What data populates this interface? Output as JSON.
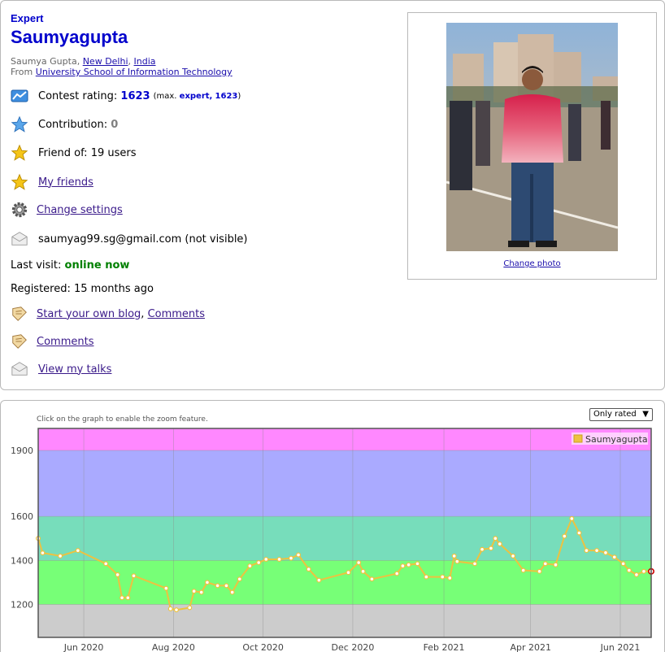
{
  "profile": {
    "rank": "Expert",
    "handle": "Saumyagupta",
    "name": "Saumya Gupta",
    "city": "New Delhi",
    "country": "India",
    "from_prefix": "From",
    "organization": "University School of Information Technology",
    "rating_label": "Contest rating:",
    "rating": "1623",
    "max_prefix": "(max.",
    "max_rank": "expert,",
    "max_rating": "1623",
    "max_suffix": ")",
    "contribution_label": "Contribution:",
    "contribution": "0",
    "friend_of": "Friend of: 19 users",
    "my_friends": "My friends",
    "change_settings": "Change settings",
    "email": "saumyag99.sg@gmail.com (not visible)",
    "last_visit_label": "Last visit:",
    "last_visit": "online now",
    "registered": "Registered: 15 months ago",
    "blog": "Start your own blog",
    "comma": ",",
    "comments_inline": "Comments",
    "comments": "Comments",
    "talks": "View my talks",
    "change_photo": "Change photo"
  },
  "graph": {
    "hint": "Click on the graph to enable the zoom feature.",
    "filter": "Only rated"
  },
  "colors": {
    "handle": "#0000cc",
    "band_expert": "#aaaaff",
    "band_specialist": "#77ddbb",
    "band_pupil": "#77ff77",
    "band_newbie": "#cccccc",
    "band_cm": "#ff88ff",
    "line": "#edc240",
    "last_point": "#cc0000"
  },
  "chart_data": {
    "type": "line",
    "title": "",
    "xlabel": "",
    "ylabel": "",
    "ylim": [
      1050,
      2000
    ],
    "xlim": [
      "2020-05-01",
      "2021-06-22"
    ],
    "x_ticks": [
      "Jun 2020",
      "Aug 2020",
      "Oct 2020",
      "Dec 2020",
      "Feb 2021",
      "Apr 2021",
      "Jun 2021"
    ],
    "y_ticks": [
      1200,
      1400,
      1600,
      1900
    ],
    "bands": [
      {
        "from": 1050,
        "to": 1200,
        "color": "#cccccc"
      },
      {
        "from": 1200,
        "to": 1400,
        "color": "#77ff77"
      },
      {
        "from": 1400,
        "to": 1600,
        "color": "#77ddbb"
      },
      {
        "from": 1600,
        "to": 1900,
        "color": "#aaaaff"
      },
      {
        "from": 1900,
        "to": 2000,
        "color": "#ff88ff"
      }
    ],
    "grid": true,
    "legend": "top-right",
    "series": [
      {
        "name": "Saumyagupta",
        "points": [
          [
            "2020-05-01",
            1500
          ],
          [
            "2020-05-04",
            1434
          ],
          [
            "2020-05-16",
            1420
          ],
          [
            "2020-05-28",
            1445
          ],
          [
            "2020-06-16",
            1385
          ],
          [
            "2020-06-24",
            1335
          ],
          [
            "2020-06-27",
            1230
          ],
          [
            "2020-07-01",
            1230
          ],
          [
            "2020-07-05",
            1330
          ],
          [
            "2020-07-27",
            1273
          ],
          [
            "2020-07-30",
            1180
          ],
          [
            "2020-08-03",
            1175
          ],
          [
            "2020-08-12",
            1185
          ],
          [
            "2020-08-15",
            1260
          ],
          [
            "2020-08-20",
            1255
          ],
          [
            "2020-08-24",
            1300
          ],
          [
            "2020-08-31",
            1285
          ],
          [
            "2020-09-06",
            1285
          ],
          [
            "2020-09-10",
            1255
          ],
          [
            "2020-09-15",
            1315
          ],
          [
            "2020-09-22",
            1375
          ],
          [
            "2020-09-28",
            1390
          ],
          [
            "2020-10-03",
            1405
          ],
          [
            "2020-10-12",
            1405
          ],
          [
            "2020-10-20",
            1410
          ],
          [
            "2020-10-25",
            1425
          ],
          [
            "2020-11-01",
            1360
          ],
          [
            "2020-11-08",
            1310
          ],
          [
            "2020-11-28",
            1345
          ],
          [
            "2020-12-05",
            1390
          ],
          [
            "2020-12-08",
            1350
          ],
          [
            "2020-12-14",
            1315
          ],
          [
            "2020-12-31",
            1340
          ],
          [
            "2021-01-04",
            1375
          ],
          [
            "2021-01-08",
            1380
          ],
          [
            "2021-01-14",
            1385
          ],
          [
            "2021-01-20",
            1325
          ],
          [
            "2021-01-31",
            1325
          ],
          [
            "2021-02-05",
            1320
          ],
          [
            "2021-02-08",
            1420
          ],
          [
            "2021-02-10",
            1395
          ],
          [
            "2021-02-22",
            1385
          ],
          [
            "2021-02-27",
            1450
          ],
          [
            "2021-03-05",
            1455
          ],
          [
            "2021-03-08",
            1500
          ],
          [
            "2021-03-11",
            1475
          ],
          [
            "2021-03-20",
            1420
          ],
          [
            "2021-03-27",
            1355
          ],
          [
            "2021-04-07",
            1350
          ],
          [
            "2021-04-11",
            1385
          ],
          [
            "2021-04-18",
            1380
          ],
          [
            "2021-04-24",
            1510
          ],
          [
            "2021-04-29",
            1590
          ],
          [
            "2021-05-04",
            1525
          ],
          [
            "2021-05-09",
            1445
          ],
          [
            "2021-05-16",
            1445
          ],
          [
            "2021-05-22",
            1435
          ],
          [
            "2021-05-28",
            1415
          ],
          [
            "2021-06-03",
            1385
          ],
          [
            "2021-06-07",
            1355
          ],
          [
            "2021-06-12",
            1335
          ],
          [
            "2021-06-17",
            1350
          ],
          [
            "2021-06-22",
            1350
          ]
        ]
      }
    ]
  }
}
